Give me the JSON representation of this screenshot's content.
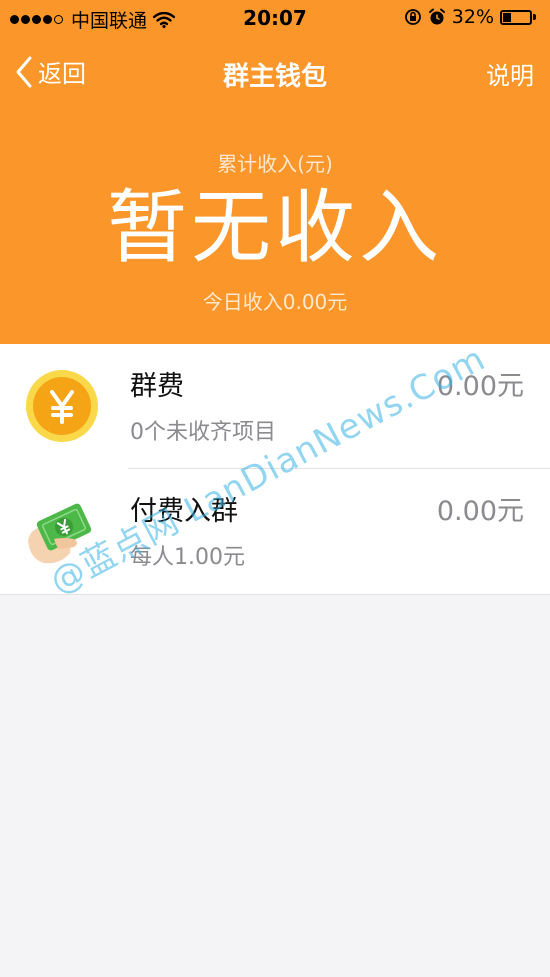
{
  "status_bar": {
    "carrier": "中国联通",
    "time": "20:07",
    "battery_percent": "32%",
    "battery_level": 0.32
  },
  "nav": {
    "back_label": "返回",
    "title": "群主钱包",
    "help_label": "说明"
  },
  "summary": {
    "label": "累计收入(元)",
    "amount": "暂无收入",
    "today": "今日收入0.00元"
  },
  "items": [
    {
      "icon": "coin-yuan-icon",
      "title": "群费",
      "subtitle": "0个未收齐项目",
      "amount": "0.00元"
    },
    {
      "icon": "cash-hand-icon",
      "title": "付费入群",
      "subtitle": "每人1.00元",
      "amount": "0.00元"
    }
  ],
  "watermark": "@蓝点网 LanDianNews.Com",
  "colors": {
    "header_orange": "#fb972a",
    "coin_yellow": "#f7c21d",
    "coin_orange": "#f29a12",
    "cash_green": "#4cb848",
    "hand_skin": "#f6d3b0",
    "watermark_blue": "#38b2e6"
  }
}
